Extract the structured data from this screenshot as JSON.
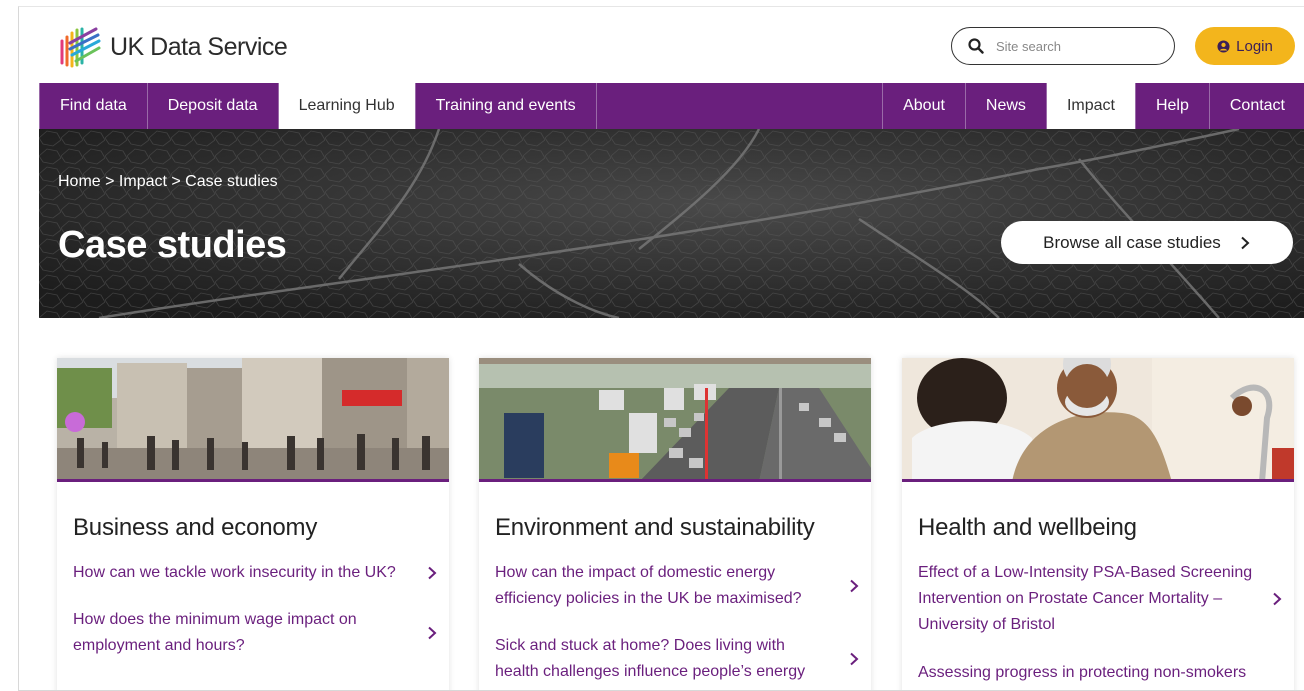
{
  "brand": {
    "name": "UK Data Service"
  },
  "header": {
    "search_placeholder": "Site search",
    "login_label": "Login"
  },
  "nav": {
    "left": [
      {
        "label": "Find data"
      },
      {
        "label": "Deposit data"
      },
      {
        "label": "Learning Hub"
      },
      {
        "label": "Training and events"
      }
    ],
    "right": [
      {
        "label": "About"
      },
      {
        "label": "News"
      },
      {
        "label": "Impact"
      },
      {
        "label": "Help"
      },
      {
        "label": "Contact"
      }
    ]
  },
  "hero": {
    "breadcrumb": "Home > Impact > Case studies",
    "title": "Case studies",
    "browse_label": "Browse all case studies"
  },
  "cards": [
    {
      "title": "Business and economy",
      "links": [
        "How can we tackle work insecurity in the UK?",
        "How does the minimum wage impact on employment and hours?"
      ]
    },
    {
      "title": "Environment and sustainability",
      "links": [
        "How can the impact of domestic energy efficiency policies in the UK be maximised?",
        "Sick and stuck at home? Does living with health challenges influence people’s energy"
      ]
    },
    {
      "title": "Health and wellbeing",
      "links": [
        "Effect of a Low-Intensity PSA-Based Screening Intervention on Prostate Cancer Mortality – University of Bristol",
        "Assessing progress in protecting non-smokers"
      ]
    }
  ],
  "colors": {
    "primary_purple": "#6a1f7d",
    "login_yellow": "#f3b51c",
    "hero_dark": "#2a2a2a"
  },
  "icons": {
    "search": "search-icon",
    "login": "user-circle-icon",
    "chevron": "chevron-right-icon"
  }
}
